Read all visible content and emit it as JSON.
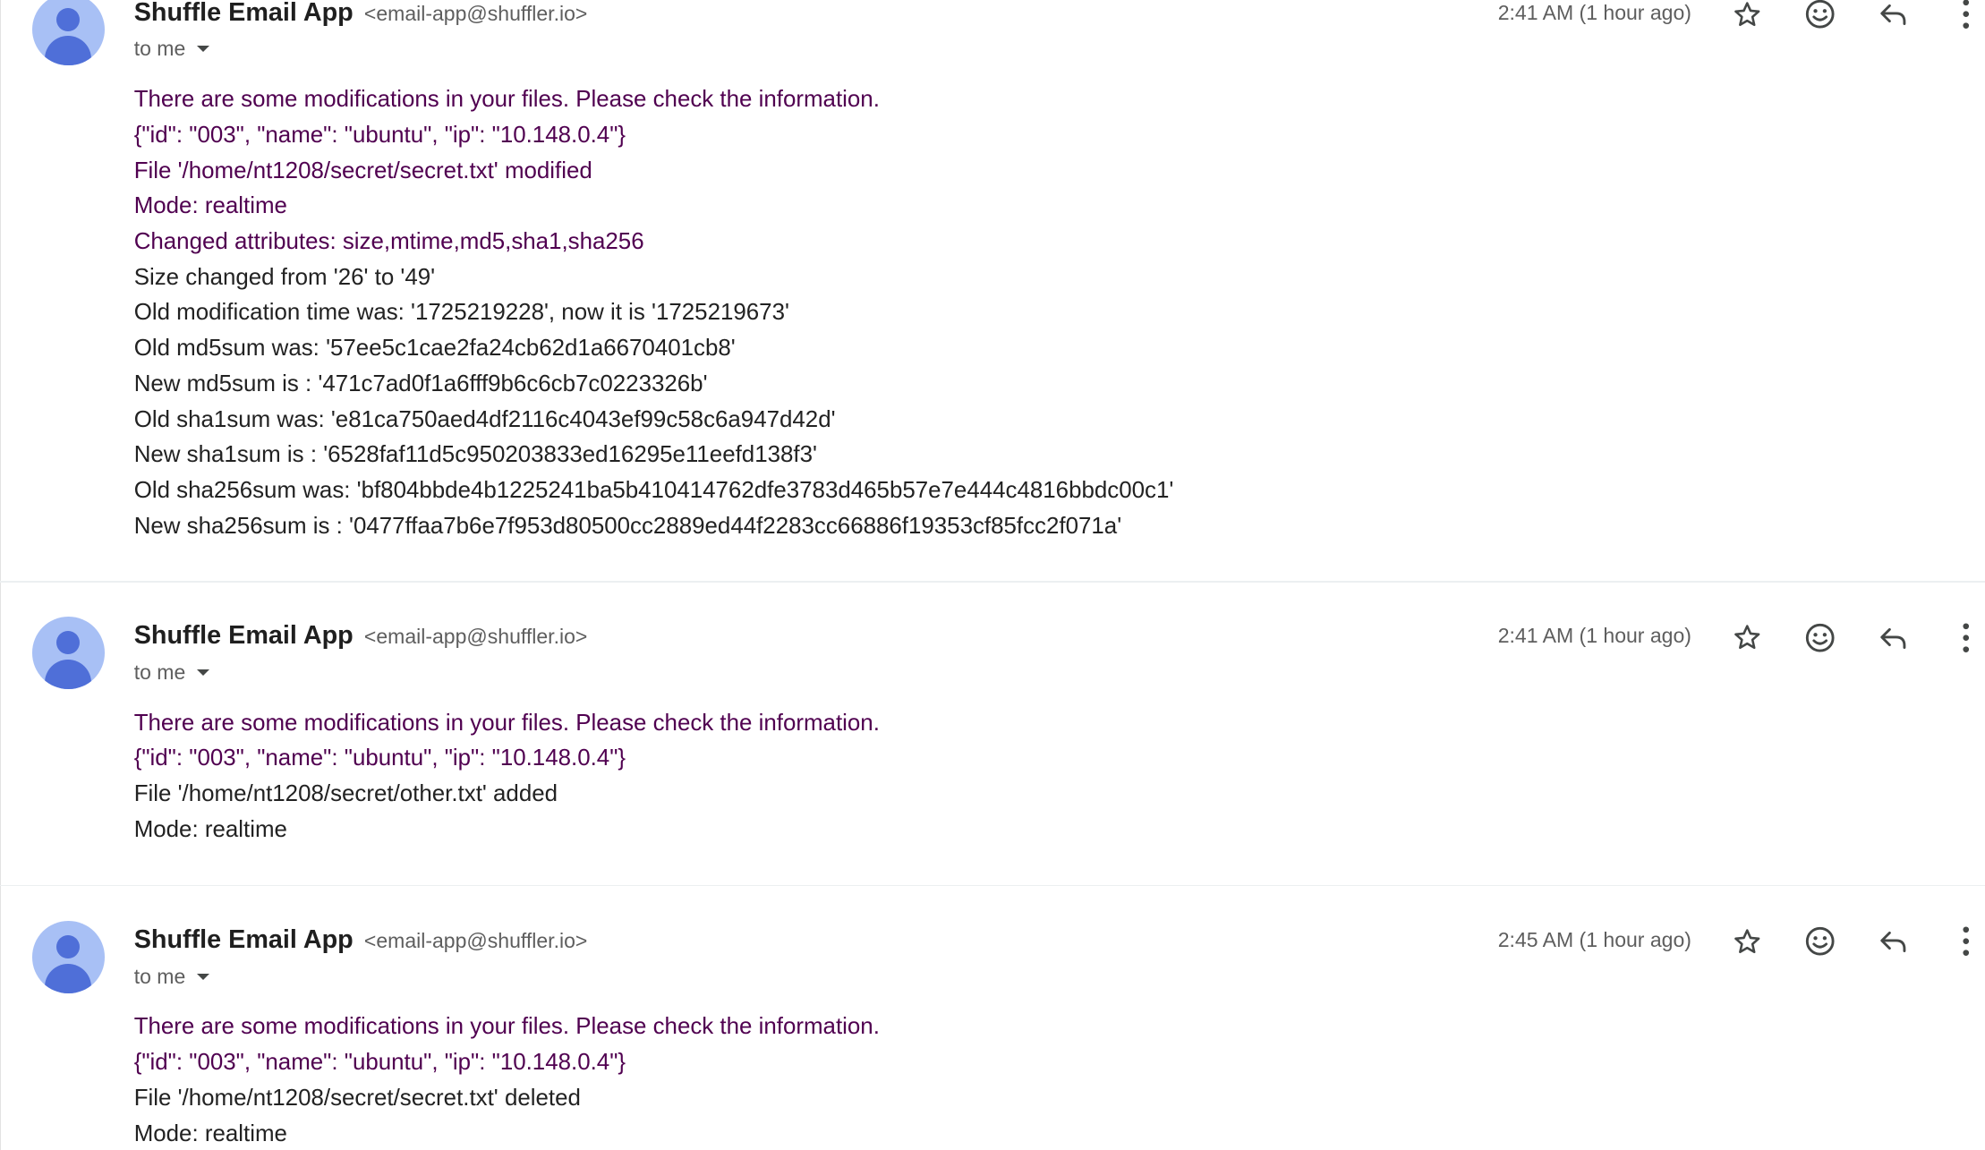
{
  "messages": [
    {
      "sender_name": "Shuffle Email App",
      "sender_email": "<email-app@shuffler.io>",
      "to_label": "to me",
      "timestamp": "2:41 AM (1 hour ago)",
      "lines": [
        {
          "text": "There are some modifications in your files. Please check the information.",
          "color": "#500050"
        },
        {
          "text": "{\"id\": \"003\", \"name\": \"ubuntu\", \"ip\": \"10.148.0.4\"}",
          "color": "#500050"
        },
        {
          "text": "File '/home/nt1208/secret/secret.txt' modified",
          "color": "#500050"
        },
        {
          "text": "Mode: realtime",
          "color": "#500050"
        },
        {
          "text": "Changed attributes: size,mtime,md5,sha1,sha256",
          "color": "#500050"
        },
        {
          "text": "Size changed from '26' to '49'",
          "color": "#222222"
        },
        {
          "text": "Old modification time was: '1725219228', now it is '1725219673'",
          "color": "#222222"
        },
        {
          "text": "Old md5sum was: '57ee5c1cae2fa24cb62d1a6670401cb8'",
          "color": "#222222"
        },
        {
          "text": "New md5sum is : '471c7ad0f1a6fff9b6c6cb7c0223326b'",
          "color": "#222222"
        },
        {
          "text": "Old sha1sum was: 'e81ca750aed4df2116c4043ef99c58c6a947d42d'",
          "color": "#222222"
        },
        {
          "text": "New sha1sum is : '6528faf11d5c950203833ed16295e11eefd138f3'",
          "color": "#222222"
        },
        {
          "text": "Old sha256sum was: 'bf804bbde4b1225241ba5b410414762dfe3783d465b57e7e444c4816bbdc00c1'",
          "color": "#222222"
        },
        {
          "text": "New sha256sum is : '0477ffaa7b6e7f953d80500cc2889ed44f2283cc66886f19353cf85fcc2f071a'",
          "color": "#222222"
        }
      ]
    },
    {
      "sender_name": "Shuffle Email App",
      "sender_email": "<email-app@shuffler.io>",
      "to_label": "to me",
      "timestamp": "2:41 AM (1 hour ago)",
      "lines": [
        {
          "text": "There are some modifications in your files. Please check the information.",
          "color": "#500050"
        },
        {
          "text": "{\"id\": \"003\", \"name\": \"ubuntu\", \"ip\": \"10.148.0.4\"}",
          "color": "#500050"
        },
        {
          "text": "File '/home/nt1208/secret/other.txt' added",
          "color": "#222222"
        },
        {
          "text": "Mode: realtime",
          "color": "#222222"
        }
      ]
    },
    {
      "sender_name": "Shuffle Email App",
      "sender_email": "<email-app@shuffler.io>",
      "to_label": "to me",
      "timestamp": "2:45 AM (1 hour ago)",
      "lines": [
        {
          "text": "There are some modifications in your files. Please check the information.",
          "color": "#500050"
        },
        {
          "text": "{\"id\": \"003\", \"name\": \"ubuntu\", \"ip\": \"10.148.0.4\"}",
          "color": "#500050"
        },
        {
          "text": "File '/home/nt1208/secret/secret.txt' deleted",
          "color": "#222222"
        },
        {
          "text": "Mode: realtime",
          "color": "#222222"
        }
      ]
    }
  ],
  "icons": {
    "star": "star-icon",
    "emoji": "add-reaction-icon",
    "reply": "reply-icon",
    "more": "more-vertical-icon",
    "expand": "chevron-down-icon",
    "avatar": "default-avatar-icon"
  },
  "colors": {
    "avatar_background": "#a8c0f5",
    "avatar_figure": "#4f6fd8",
    "quoted_text": "#500050",
    "body_text": "#222222",
    "secondary_text": "#5e5e5e"
  }
}
